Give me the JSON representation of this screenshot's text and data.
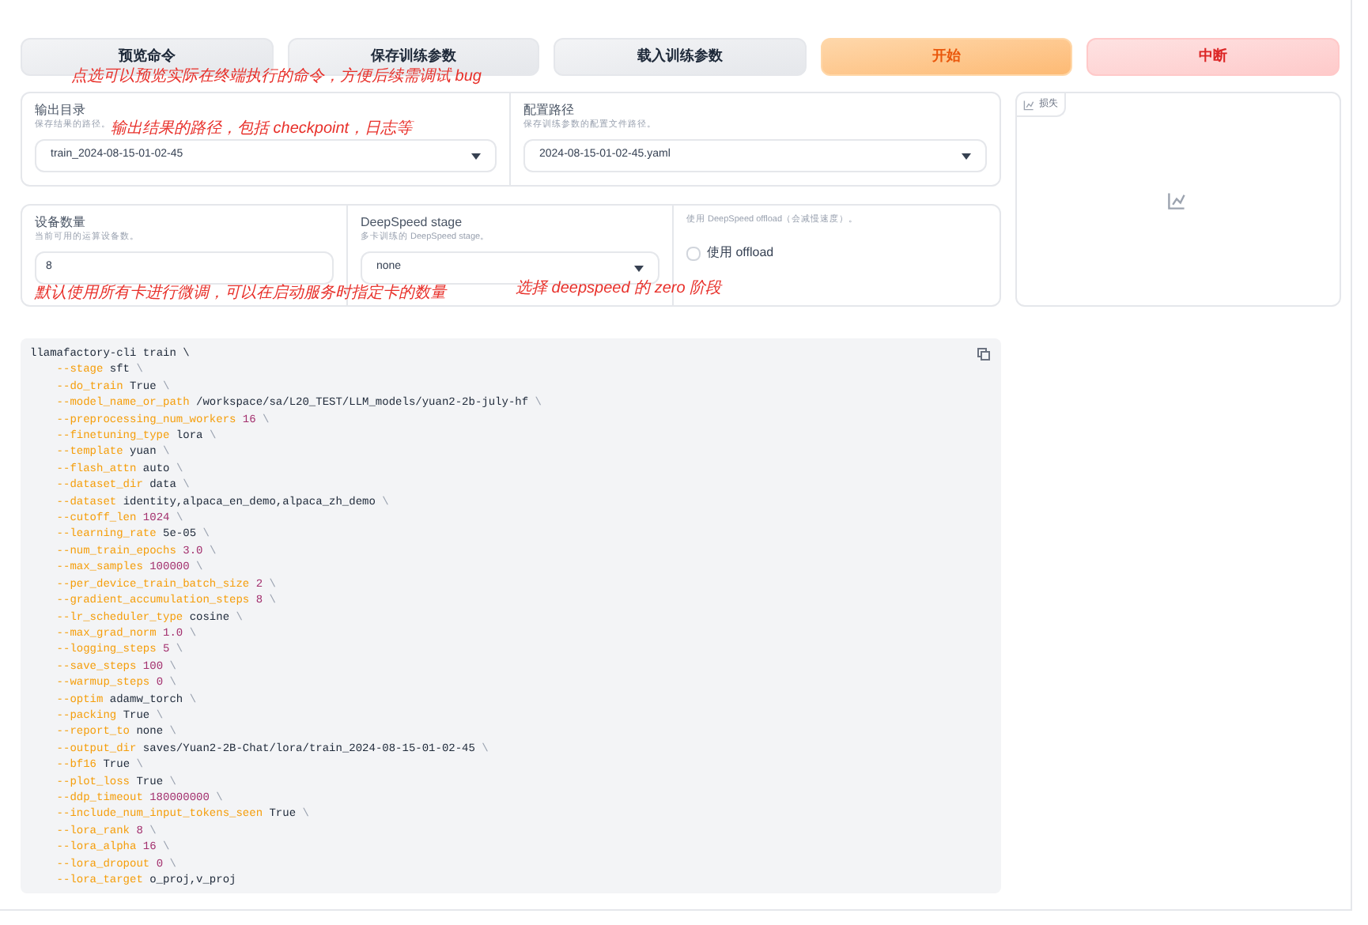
{
  "buttons": [
    {
      "label": "预览命令",
      "kind": "secondary"
    },
    {
      "label": "保存训练参数",
      "kind": "secondary"
    },
    {
      "label": "载入训练参数",
      "kind": "secondary"
    },
    {
      "label": "开始",
      "kind": "primary"
    },
    {
      "label": "中断",
      "kind": "stop"
    }
  ],
  "output_panel": [
    {
      "label": "输出目录",
      "info": "保存结果的路径。",
      "value": "train_2024-08-15-01-02-45"
    },
    {
      "label": "配置路径",
      "info": "保存训练参数的配置文件路径。",
      "value": "2024-08-15-01-02-45.yaml"
    }
  ],
  "device_panel": {
    "device_count": {
      "label": "设备数量",
      "info": "当前可用的运算设备数。",
      "value": "8"
    },
    "ds_stage": {
      "label": "DeepSpeed stage",
      "info": "多卡训练的 DeepSpeed stage。",
      "value": "none"
    },
    "ds_offload": {
      "info": "使用 DeepSpeed offload（会减慢速度）。",
      "label": "使用 offload",
      "checked": false
    }
  },
  "loss_plot": {
    "label": "损失"
  },
  "command": {
    "first_line": "llamafactory-cli train \\",
    "args": [
      {
        "flag": "--stage",
        "value": "sft",
        "kind": "text",
        "tail": "\\"
      },
      {
        "flag": "--do_train",
        "value": "True",
        "kind": "text",
        "tail": "\\"
      },
      {
        "flag": "--model_name_or_path",
        "value": "/workspace/sa/L20_TEST/LLM_models/yuan2-2b-july-hf",
        "kind": "text",
        "tail": "\\"
      },
      {
        "flag": "--preprocessing_num_workers",
        "value": "16",
        "kind": "number",
        "tail": "\\"
      },
      {
        "flag": "--finetuning_type",
        "value": "lora",
        "kind": "text",
        "tail": "\\"
      },
      {
        "flag": "--template",
        "value": "yuan",
        "kind": "text",
        "tail": "\\"
      },
      {
        "flag": "--flash_attn",
        "value": "auto",
        "kind": "text",
        "tail": "\\"
      },
      {
        "flag": "--dataset_dir",
        "value": "data",
        "kind": "text",
        "tail": "\\"
      },
      {
        "flag": "--dataset",
        "value": "identity,alpaca_en_demo,alpaca_zh_demo",
        "kind": "text",
        "tail": "\\"
      },
      {
        "flag": "--cutoff_len",
        "value": "1024",
        "kind": "number",
        "tail": "\\"
      },
      {
        "flag": "--learning_rate",
        "value": "5e-05",
        "kind": "text",
        "tail": "\\"
      },
      {
        "flag": "--num_train_epochs",
        "value": "3.0",
        "kind": "number",
        "tail": "\\"
      },
      {
        "flag": "--max_samples",
        "value": "100000",
        "kind": "number",
        "tail": "\\"
      },
      {
        "flag": "--per_device_train_batch_size",
        "value": "2",
        "kind": "number",
        "tail": "\\"
      },
      {
        "flag": "--gradient_accumulation_steps",
        "value": "8",
        "kind": "number",
        "tail": "\\"
      },
      {
        "flag": "--lr_scheduler_type",
        "value": "cosine",
        "kind": "text",
        "tail": "\\"
      },
      {
        "flag": "--max_grad_norm",
        "value": "1.0",
        "kind": "number",
        "tail": "\\"
      },
      {
        "flag": "--logging_steps",
        "value": "5",
        "kind": "number",
        "tail": "\\"
      },
      {
        "flag": "--save_steps",
        "value": "100",
        "kind": "number",
        "tail": "\\"
      },
      {
        "flag": "--warmup_steps",
        "value": "0",
        "kind": "number",
        "tail": "\\"
      },
      {
        "flag": "--optim",
        "value": "adamw_torch",
        "kind": "text",
        "tail": "\\"
      },
      {
        "flag": "--packing",
        "value": "True",
        "kind": "text",
        "tail": "\\"
      },
      {
        "flag": "--report_to",
        "value": "none",
        "kind": "text",
        "tail": "\\"
      },
      {
        "flag": "--output_dir",
        "value": "saves/Yuan2-2B-Chat/lora/train_2024-08-15-01-02-45",
        "kind": "text",
        "tail": "\\"
      },
      {
        "flag": "--bf16",
        "value": "True",
        "kind": "text",
        "tail": "\\"
      },
      {
        "flag": "--plot_loss",
        "value": "True",
        "kind": "text",
        "tail": "\\"
      },
      {
        "flag": "--ddp_timeout",
        "value": "180000000",
        "kind": "number",
        "tail": "\\"
      },
      {
        "flag": "--include_num_input_tokens_seen",
        "value": "True",
        "kind": "text",
        "tail": "\\"
      },
      {
        "flag": "--lora_rank",
        "value": "8",
        "kind": "number",
        "tail": "\\"
      },
      {
        "flag": "--lora_alpha",
        "value": "16",
        "kind": "number",
        "tail": "\\"
      },
      {
        "flag": "--lora_dropout",
        "value": "0",
        "kind": "number",
        "tail": "\\"
      },
      {
        "flag": "--lora_target",
        "value": "o_proj,v_proj",
        "kind": "text"
      }
    ]
  },
  "annotations": [
    "点选可以预览实际在终端执行的命令，方便后续需调试 bug",
    "输出结果的路径，包括 checkpoint，日志等",
    "默认使用所有卡进行微调，可以在启动服务时指定卡的数量",
    "选择 deepspeed 的 zero 阶段"
  ]
}
